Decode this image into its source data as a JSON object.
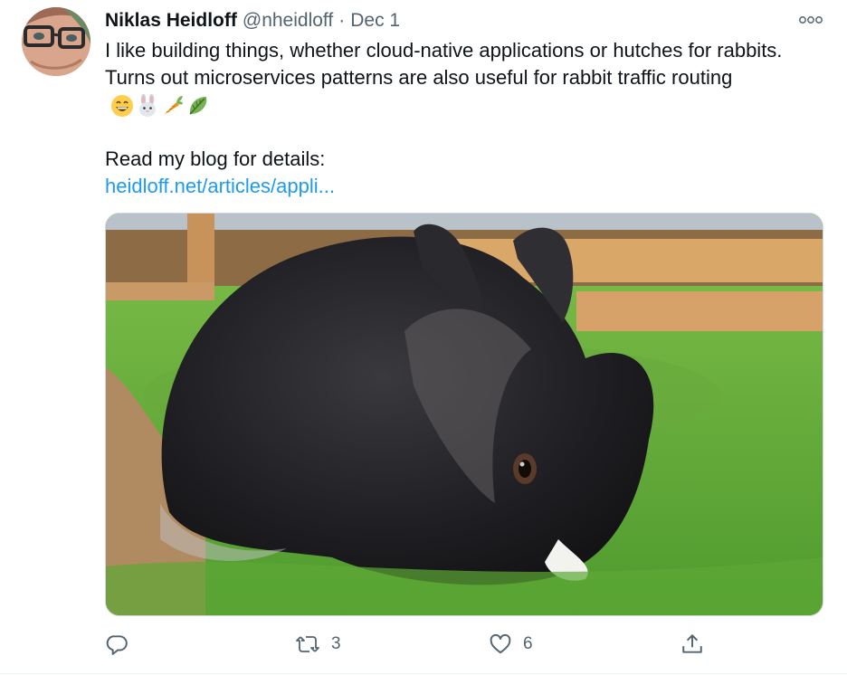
{
  "tweet": {
    "author_name": "Niklas Heidloff",
    "handle": "@nheidloff",
    "separator": "·",
    "date": "Dec 1",
    "text_main": "I like building things, whether cloud-native applications or hutches for rabbits. Turns out microservices patterns are also useful for rabbit traffic routing",
    "emojis": [
      "grinning-face-emoji",
      "rabbit-face-emoji",
      "carrot-emoji",
      "leafy-green-emoji"
    ],
    "text_read": "Read my blog for details:",
    "link_text": "heidloff.net/articles/appli..."
  },
  "actions": {
    "reply_count": "",
    "retweet_count": "3",
    "like_count": "6"
  },
  "icons": {
    "more": "more-dots-icon",
    "reply": "reply-icon",
    "retweet": "retweet-icon",
    "like": "heart-icon",
    "share": "share-icon"
  },
  "colors": {
    "link": "#1d9bf0",
    "muted": "#536471",
    "text": "#0f1419"
  }
}
